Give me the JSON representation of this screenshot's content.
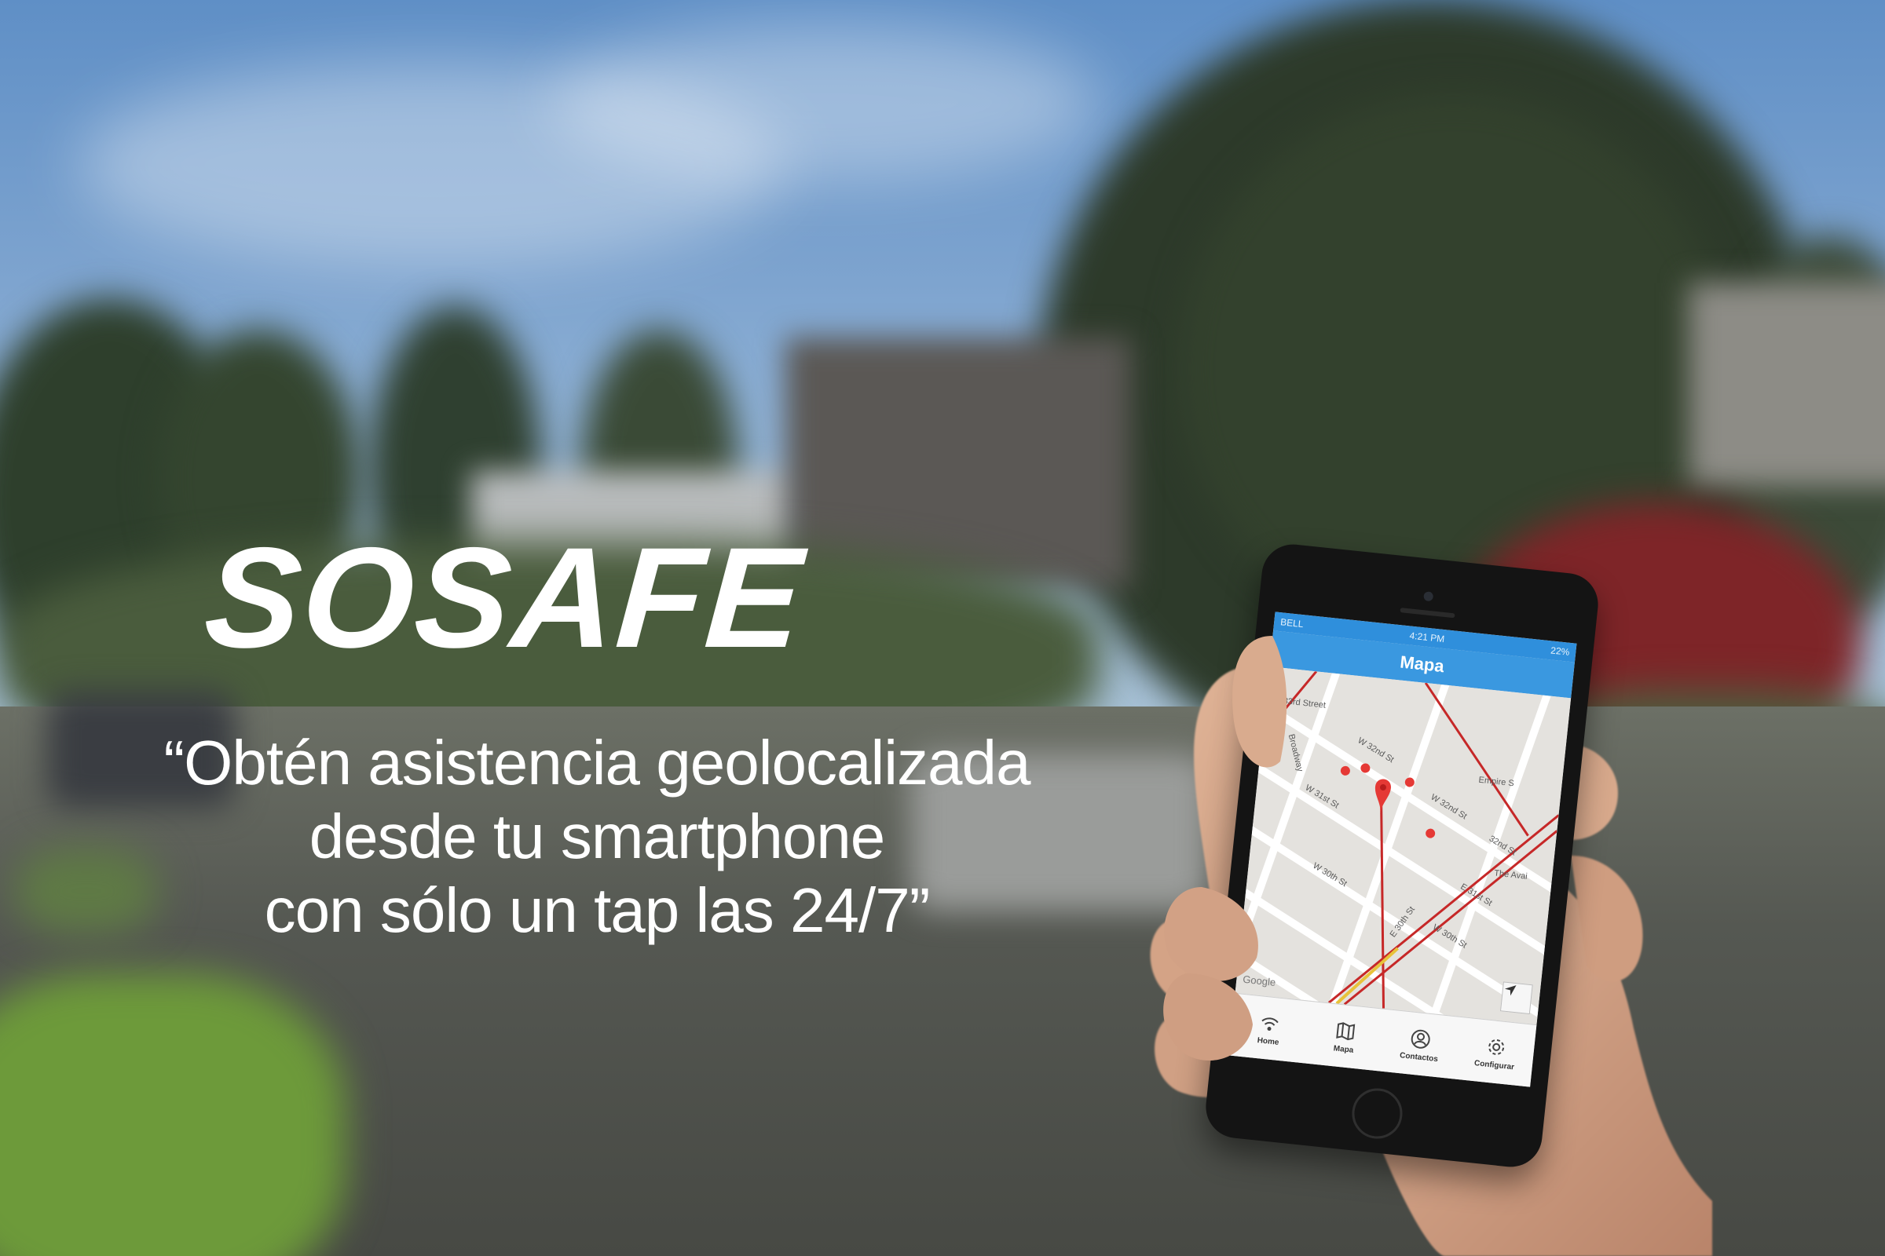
{
  "brand": {
    "name": "SOSAFE"
  },
  "tagline": {
    "line1": "“Obtén asistencia geolocalizada",
    "line2": "desde tu smartphone",
    "line3": "con sólo un tap las 24/7”"
  },
  "phone": {
    "status_bar": {
      "carrier": "BELL",
      "time": "4:21 PM",
      "battery": "22%"
    },
    "title": "Mapa",
    "map": {
      "labels": [
        "33rd Street",
        "Empire S",
        "W 32nd St",
        "W 32nd St",
        "W 31st St",
        "W 30th St",
        "W 30th St",
        "Broadway",
        "32nd St",
        "The Avai",
        "E 31st St",
        "E 30th St",
        "Google"
      ]
    },
    "tabs": [
      {
        "label": "Home",
        "icon": "wifi-icon"
      },
      {
        "label": "Mapa",
        "icon": "map-icon"
      },
      {
        "label": "Contactos",
        "icon": "contacts-icon"
      },
      {
        "label": "Configurar",
        "icon": "gear-icon"
      }
    ]
  },
  "colors": {
    "accent": "#3a98e0",
    "pin": "#e53935",
    "road_red": "#c62828",
    "text": "#ffffff"
  }
}
